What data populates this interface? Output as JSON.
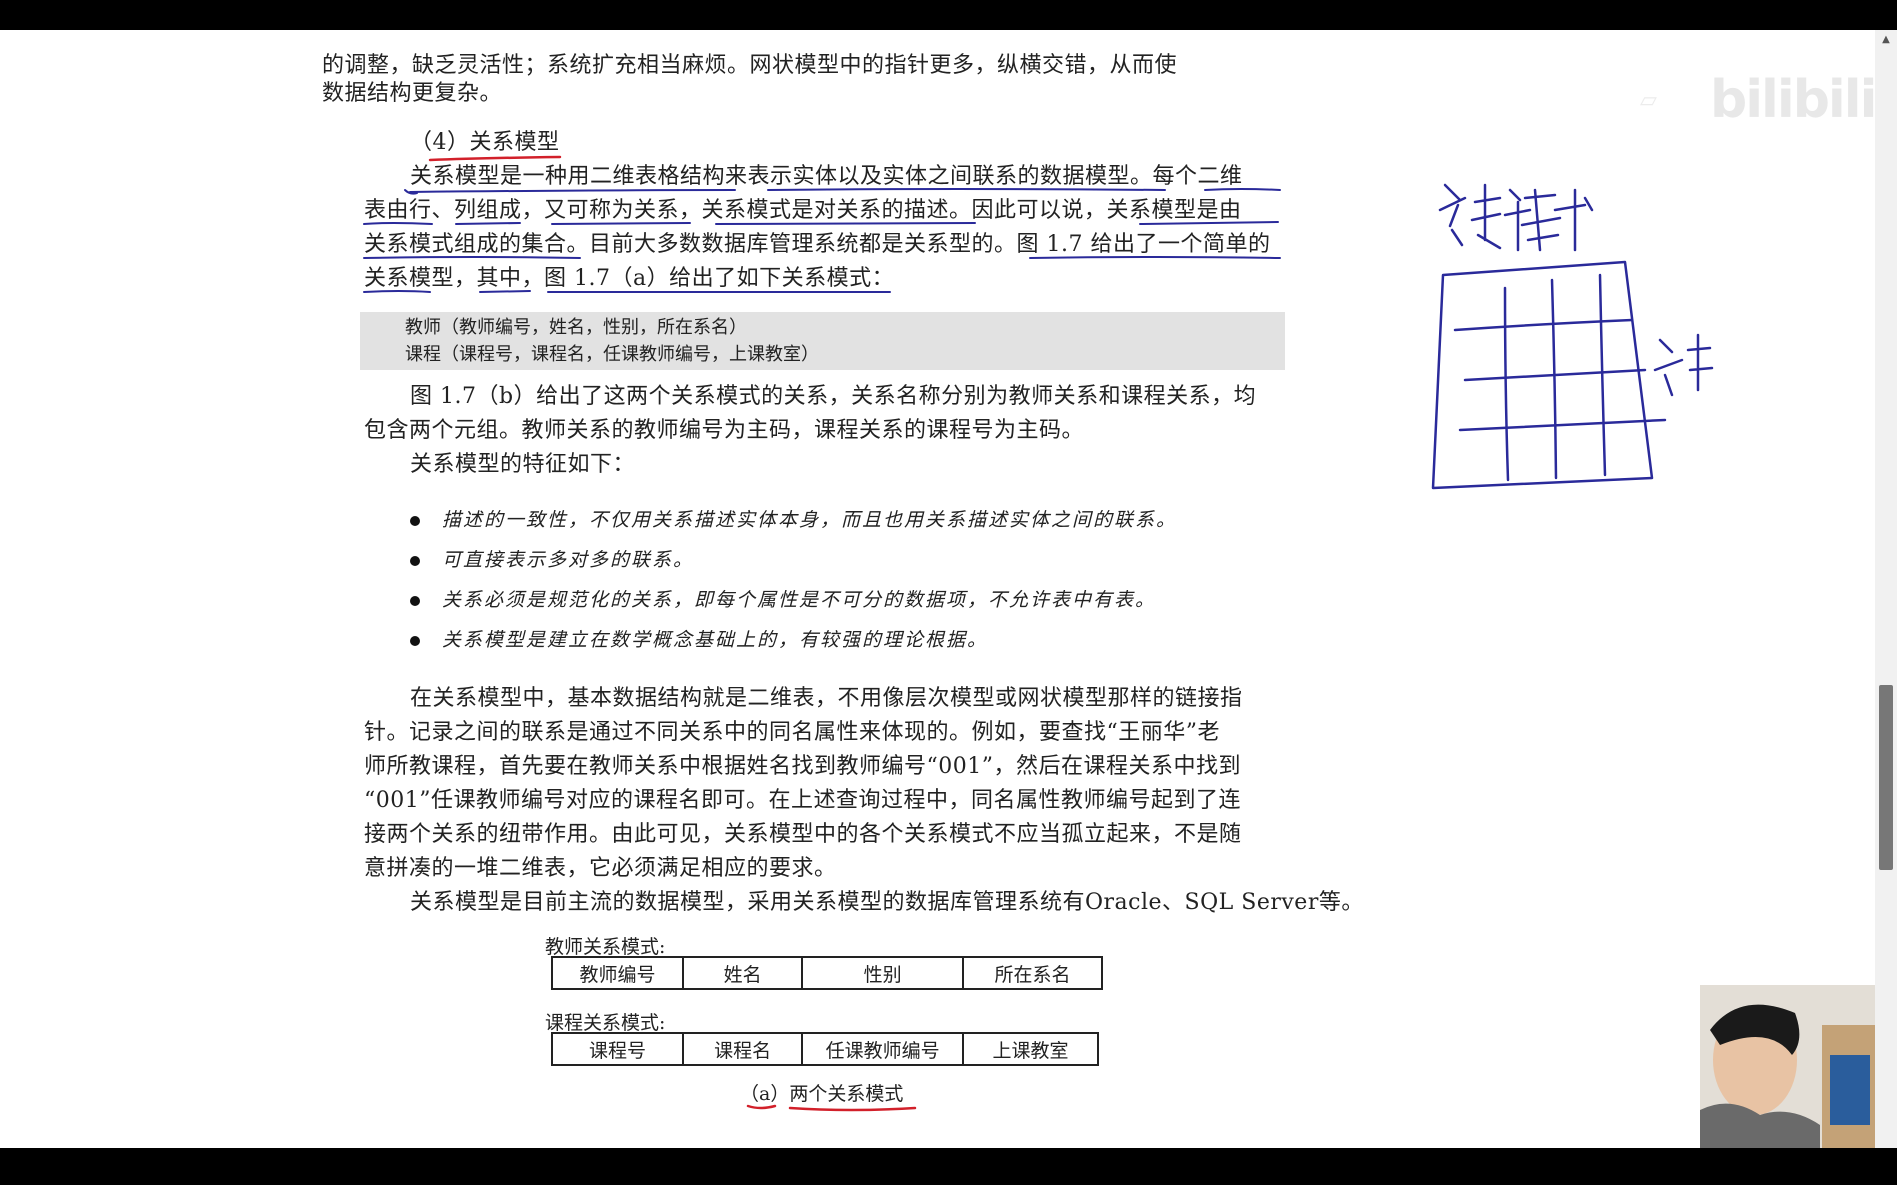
{
  "document": {
    "intro_lines": [
      "的调整，缺乏灵活性；系统扩充相当麻烦。网状模型中的指针更多，纵横交错，从而使",
      "数据结构更复杂。"
    ],
    "section_heading": "（4）关系模型",
    "para1_lines": [
      "关系模型是一种用二维表格结构来表示实体以及实体之间联系的数据模型。每个二维",
      "表由行、列组成，又可称为关系，关系模式是对关系的描述。因此可以说，关系模型是由",
      "关系模式组成的集合。目前大多数数据库管理系统都是关系型的。图 1.7 给出了一个简单的",
      "关系模型，其中，图 1.7（a）给出了如下关系模式："
    ],
    "schema_lines": [
      "教师（教师编号，姓名，性别，所在系名）",
      "课程（课程号，课程名，任课教师编号，上课教室）"
    ],
    "para2_lines": [
      "图 1.7（b）给出了这两个关系模式的关系，关系名称分别为教师关系和课程关系，均",
      "包含两个元组。教师关系的教师编号为主码，课程关系的课程号为主码。",
      "关系模型的特征如下："
    ],
    "features": [
      "描述的一致性，不仅用关系描述实体本身，而且也用关系描述实体之间的联系。",
      "可直接表示多对多的联系。",
      "关系必须是规范化的关系，即每个属性是不可分的数据项，不允许表中有表。",
      "关系模型是建立在数学概念基础上的，有较强的理论根据。"
    ],
    "para3_lines": [
      "在关系模型中，基本数据结构就是二维表，不用像层次模型或网状模型那样的链接指",
      "针。记录之间的联系是通过不同关系中的同名属性来体现的。例如，要查找“王丽华”老",
      "师所教课程，首先要在教师关系中根据姓名找到教师编号“001”，然后在课程关系中找到",
      "“001”任课教师编号对应的课程名即可。在上述查询过程中，同名属性教师编号起到了连",
      "接两个关系的纽带作用。由此可见，关系模型中的各个关系模式不应当孤立起来，不是随",
      "意拼凑的一堆二维表，它必须满足相应的要求。",
      "关系模型是目前主流的数据模型，采用关系模型的数据库管理系统有Oracle、SQL Server等。"
    ],
    "figure": {
      "teacher_label": "教师关系模式:",
      "teacher_columns": [
        "教师编号",
        "姓名",
        "性别",
        "所在系名"
      ],
      "course_label": "课程关系模式:",
      "course_columns": [
        "课程号",
        "课程名",
        "任课教师编号",
        "上课教室"
      ],
      "caption": "（a）两个关系模式"
    }
  },
  "watermark": {
    "logo_text": "bilibili"
  },
  "colors": {
    "annotation_pen": "#2a2a9a",
    "underline_red": "#d2202a",
    "page_background": "#ffffff",
    "schema_box": "#e2e2e2"
  }
}
